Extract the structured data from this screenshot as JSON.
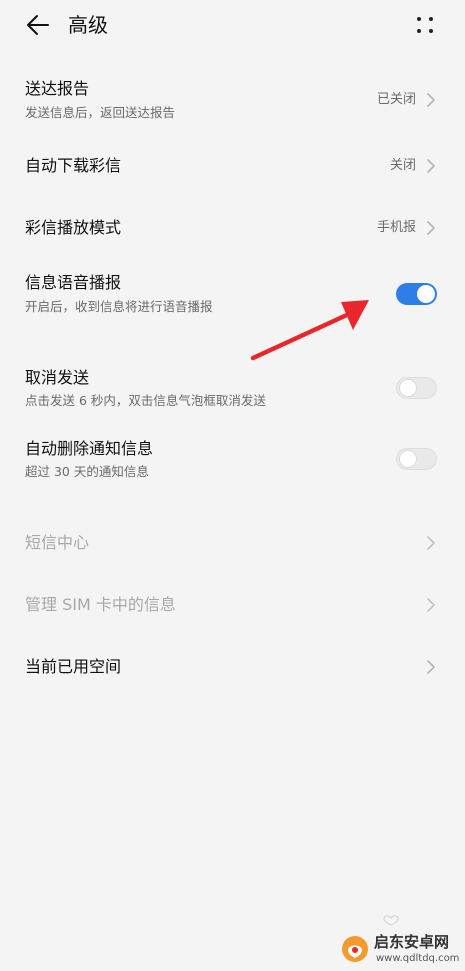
{
  "header": {
    "title": "高级",
    "back_icon": "arrow-left-icon",
    "more_icon": "more-dots-icon"
  },
  "rows": {
    "delivery_report": {
      "label": "送达报告",
      "subtitle": "发送信息后，返回送达报告",
      "value": "已关闭"
    },
    "auto_download_mms": {
      "label": "自动下载彩信",
      "value": "关闭"
    },
    "mms_playback_mode": {
      "label": "彩信播放模式",
      "value": "手机报"
    },
    "voice_broadcast": {
      "label": "信息语音播报",
      "subtitle": "开启后，收到信息将进行语音播报",
      "enabled": true
    },
    "cancel_send": {
      "label": "取消发送",
      "subtitle": "点击发送 6 秒内，双击信息气泡框取消发送",
      "enabled": false
    },
    "auto_delete_notifications": {
      "label": "自动删除通知信息",
      "subtitle": "超过 30 天的通知信息",
      "enabled": false
    },
    "sms_center": {
      "label": "短信中心"
    },
    "manage_sim_messages": {
      "label": "管理 SIM 卡中的信息"
    },
    "storage_used": {
      "label": "当前已用空间"
    }
  },
  "colors": {
    "toggle_on": "#2f7ee8",
    "toggle_off": "#e9e9e9",
    "annotation_arrow": "#e8262c",
    "background": "#f4f4f4"
  },
  "watermark": {
    "name": "启东安卓网",
    "url": "www.qdltdq.com"
  }
}
